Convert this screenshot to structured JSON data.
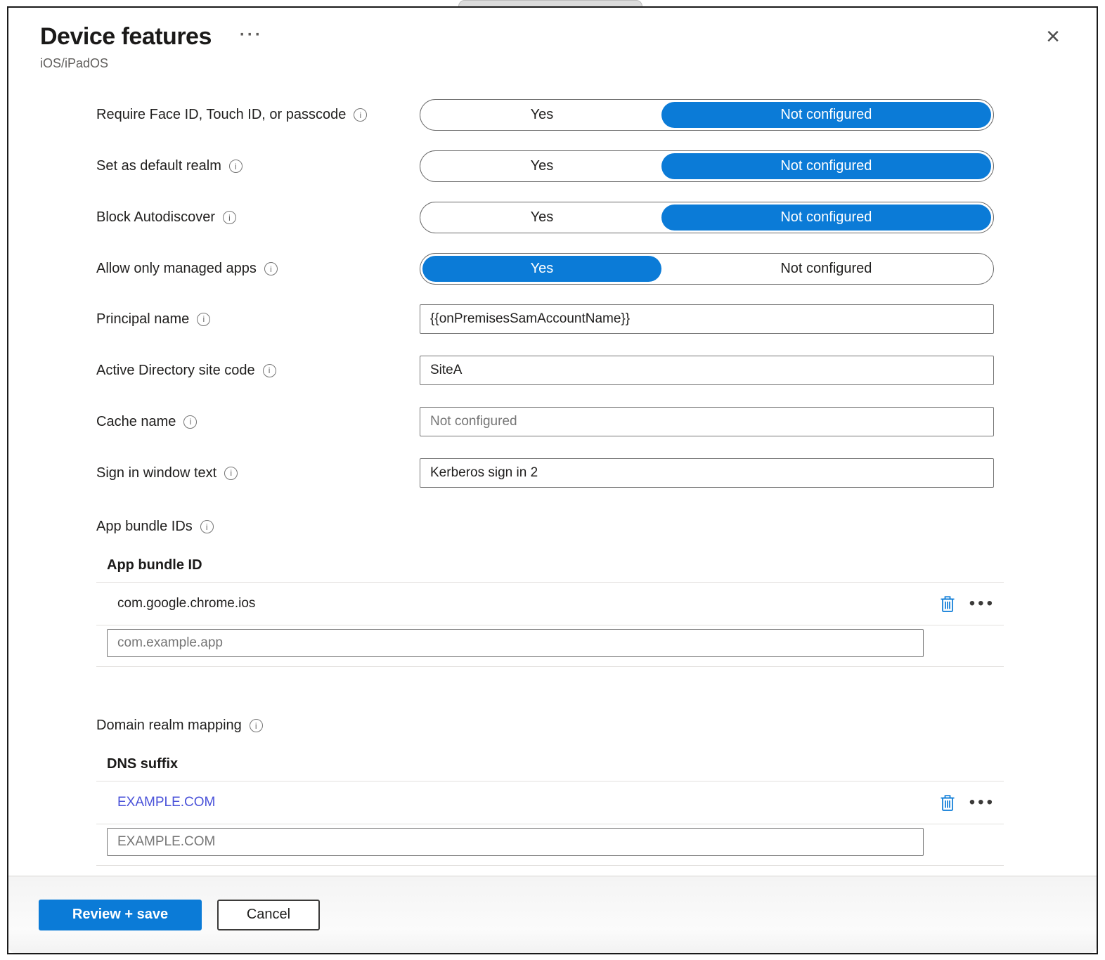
{
  "panel": {
    "title": "Device features",
    "subtitle": "iOS/iPadOS"
  },
  "icons": {
    "title_more": "···",
    "close": "×",
    "info": "i",
    "more_options": "•••"
  },
  "colors": {
    "accent": "#0b7bd7",
    "link": "#4a52d9"
  },
  "toggles": [
    {
      "label": "Require Face ID, Touch ID, or passcode",
      "options": [
        "Yes",
        "Not configured"
      ],
      "selected": "Not configured",
      "selected_index": 1
    },
    {
      "label": "Set as default realm",
      "options": [
        "Yes",
        "Not configured"
      ],
      "selected": "Not configured",
      "selected_index": 1
    },
    {
      "label": "Block Autodiscover",
      "options": [
        "Yes",
        "Not configured"
      ],
      "selected": "Not configured",
      "selected_index": 1
    },
    {
      "label": "Allow only managed apps",
      "options": [
        "Yes",
        "Not configured"
      ],
      "selected": "Yes",
      "selected_index": 0
    }
  ],
  "fields": [
    {
      "label": "Principal name",
      "value": "{{onPremisesSamAccountName}}",
      "placeholder": ""
    },
    {
      "label": "Active Directory site code",
      "value": "SiteA",
      "placeholder": ""
    },
    {
      "label": "Cache name",
      "value": "",
      "placeholder": "Not configured"
    },
    {
      "label": "Sign in window text",
      "value": "Kerberos sign in 2",
      "placeholder": ""
    }
  ],
  "app_bundle": {
    "label": "App bundle IDs",
    "column_header": "App bundle ID",
    "rows": [
      {
        "value": "com.google.chrome.ios"
      }
    ],
    "input_placeholder": "com.example.app"
  },
  "domain_realm": {
    "label": "Domain realm mapping",
    "column_header": "DNS suffix",
    "rows": [
      {
        "value": "EXAMPLE.COM"
      }
    ],
    "input_placeholder": "EXAMPLE.COM"
  },
  "footer": {
    "primary_label": "Review + save",
    "secondary_label": "Cancel"
  }
}
